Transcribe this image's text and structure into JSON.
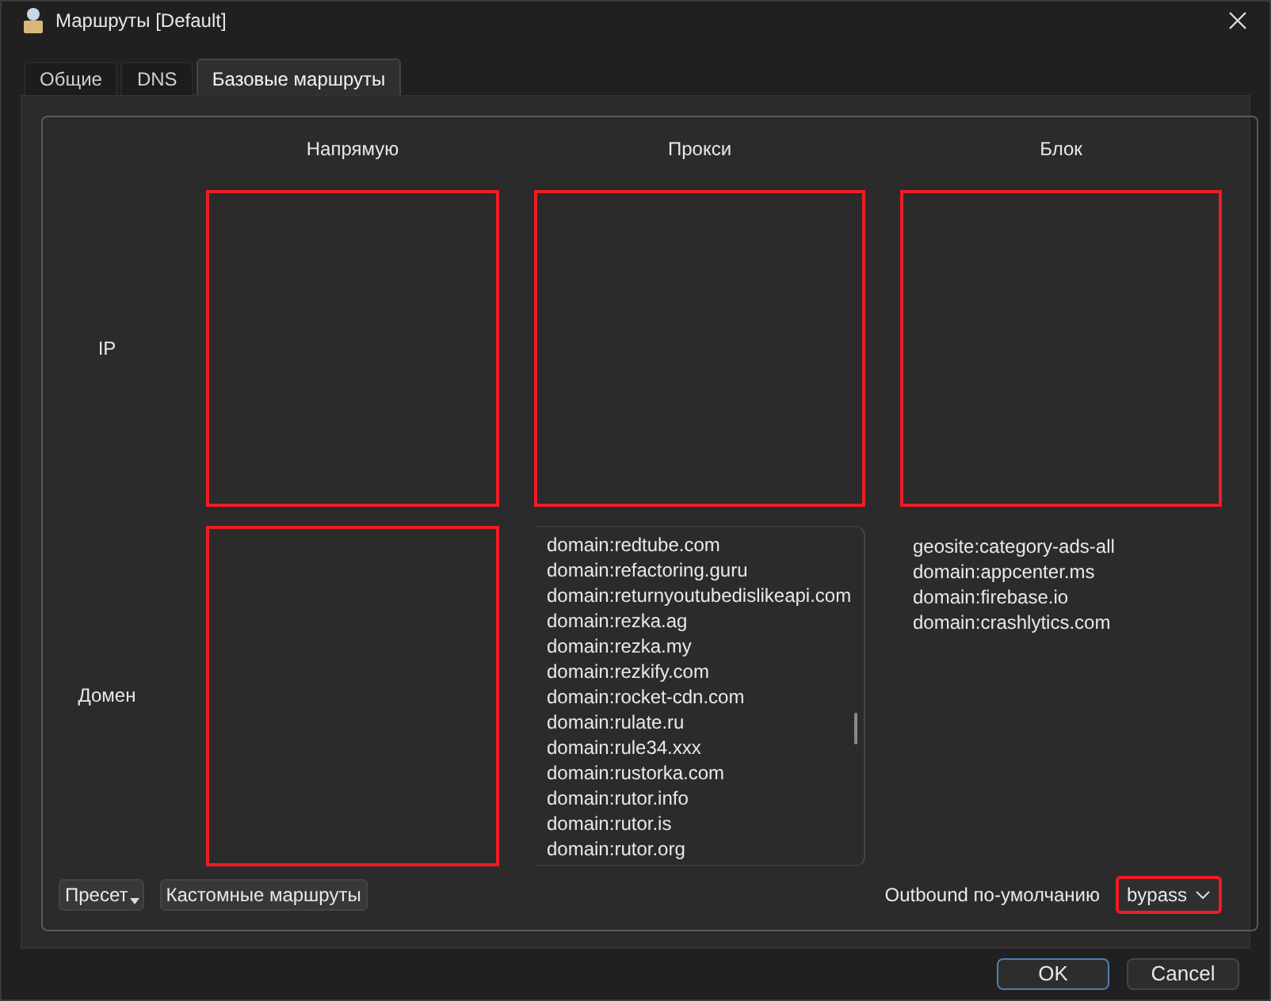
{
  "window": {
    "title": "Маршруты [Default]"
  },
  "tabs": [
    {
      "label": "Общие",
      "selected": false
    },
    {
      "label": "DNS",
      "selected": false
    },
    {
      "label": "Базовые маршруты",
      "selected": true
    }
  ],
  "columns": [
    "Напрямую",
    "Прокси",
    "Блок"
  ],
  "rows": [
    {
      "label": "IP",
      "cells": [
        {
          "highlighted": true,
          "scrollable": false
        },
        {
          "highlighted": true,
          "scrollable": false
        },
        {
          "highlighted": true,
          "scrollable": false
        }
      ]
    },
    {
      "label": "Домен",
      "cells": [
        {
          "highlighted": true,
          "scrollable": false
        },
        {
          "highlighted": false,
          "scrollable": true,
          "lines": [
            "domain:redtube.com",
            "domain:refactoring.guru",
            "domain:returnyoutubedislikeapi.com",
            "domain:rezka.ag",
            "domain:rezka.my",
            "domain:rezkify.com",
            "domain:rocket-cdn.com",
            "domain:rulate.ru",
            "domain:rule34.xxx",
            "domain:rustorka.com",
            "domain:rutor.info",
            "domain:rutor.is",
            "domain:rutor.org"
          ]
        },
        {
          "highlighted": false,
          "scrollable": false,
          "lines": [
            "geosite:category-ads-all",
            "domain:appcenter.ms",
            "domain:firebase.io",
            "domain:crashlytics.com"
          ]
        }
      ]
    }
  ],
  "preset_button": "Пресет",
  "custom_button": "Кастомные маршруты",
  "outbound": {
    "label": "Outbound по-умолчанию",
    "value": "bypass",
    "highlighted": true
  },
  "buttons": [
    {
      "label": "OK",
      "primary": true
    },
    {
      "label": "Cancel",
      "primary": false
    }
  ]
}
